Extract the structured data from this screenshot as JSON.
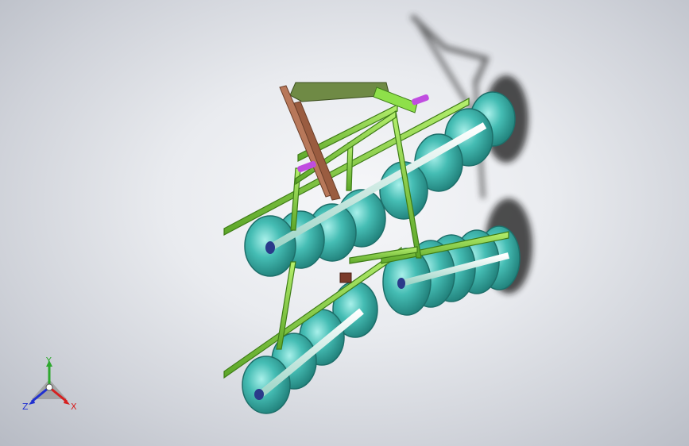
{
  "viewport": {
    "model_label": "",
    "colors": {
      "background_center": "#f3f4f6",
      "background_edge": "#b7bbc4",
      "frame_green": "#8ee04a",
      "frame_dark_green": "#4f8f1f",
      "disc_teal": "#3fb8b0",
      "disc_dark": "#1d6f6a",
      "hitch_brown": "#b8785a",
      "pin_purple": "#c04de0",
      "shadow": "#1a1a1a"
    }
  },
  "triad": {
    "x_label": "X",
    "y_label": "Y",
    "z_label": "Z",
    "x_color": "#d62020",
    "y_color": "#2ea82e",
    "z_color": "#2030d0"
  }
}
